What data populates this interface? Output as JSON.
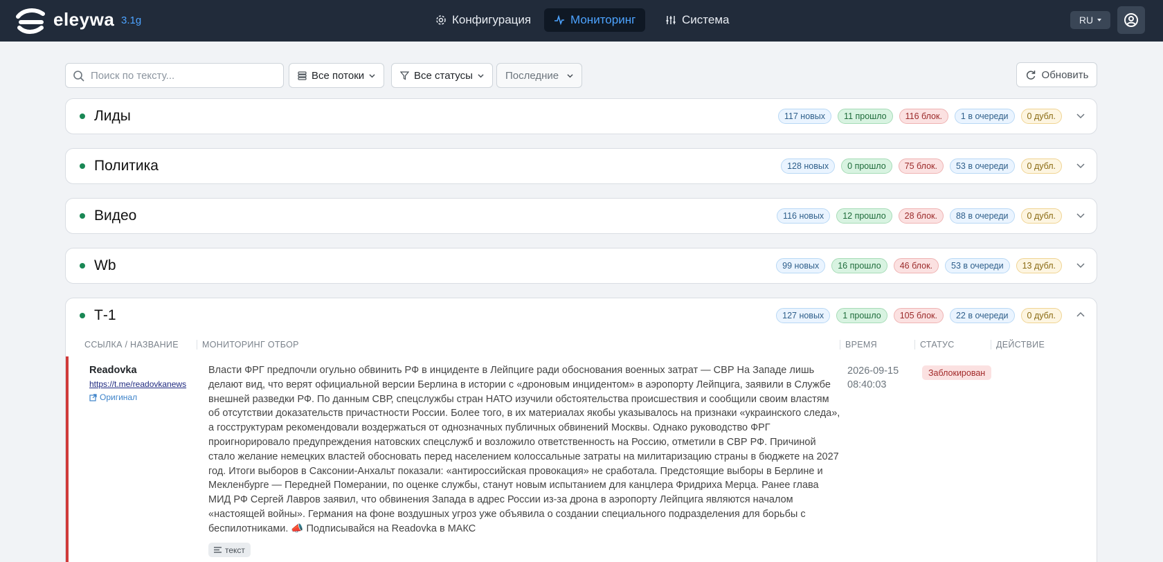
{
  "header": {
    "logo_text": "eleywa",
    "version": "3.1g",
    "nav": [
      {
        "label": "Конфигурация",
        "icon": "gear-icon",
        "active": false
      },
      {
        "label": "Мониторинг",
        "icon": "activity-icon",
        "active": true
      },
      {
        "label": "Система",
        "icon": "sliders-icon",
        "active": false
      }
    ],
    "lang": "RU",
    "user_icon": "user-circle-icon"
  },
  "filters": {
    "search_placeholder": "Поиск по тексту...",
    "streams_label": "Все потоки",
    "statuses_label": "Все статусы",
    "order_label": "Последние",
    "refresh_label": "Обновить"
  },
  "streams": [
    {
      "name": "Лиды",
      "new": "117 новых",
      "passed": "11 прошло",
      "blocked": "116 блок.",
      "queue": "1 в очереди",
      "dup": "0 дубл.",
      "expanded": false
    },
    {
      "name": "Политика",
      "new": "128 новых",
      "passed": "0 прошло",
      "blocked": "75 блок.",
      "queue": "53 в очереди",
      "dup": "0 дубл.",
      "expanded": false
    },
    {
      "name": "Видео",
      "new": "116 новых",
      "passed": "12 прошло",
      "blocked": "28 блок.",
      "queue": "88 в очереди",
      "dup": "0 дубл.",
      "expanded": false
    },
    {
      "name": "Wb",
      "new": "99 новых",
      "passed": "16 прошло",
      "blocked": "46 блок.",
      "queue": "53 в очереди",
      "dup": "13 дубл.",
      "expanded": false
    },
    {
      "name": "Т-1",
      "new": "127 новых",
      "passed": "1 прошло",
      "blocked": "105 блок.",
      "queue": "22 в очереди",
      "dup": "0 дубл.",
      "expanded": true
    }
  ],
  "table": {
    "columns": [
      "ССЫЛКА / НАЗВАНИЕ",
      "МОНИТОРИНГ ОТБОР",
      "ВРЕМЯ",
      "СТАТУС",
      "ДЕЙСТВИЕ"
    ],
    "row": {
      "source_name": "Readovka",
      "source_link": "https://t.me/readovkanews",
      "original_label": "Оригинал",
      "message": "Власти ФРГ предпочли огульно обвинить РФ в инциденте в Лейпциге ради обоснования военных затрат — СВР На Западе лишь делают вид, что верят официальной версии Берлина в истории с «дроновым инцидентом» в аэропорту Лейпцига, заявили в Службе внешней разведки РФ. По данным СВР, спецслужбы стран НАТО изучили обстоятельства происшествия и сообщили своим властям об отсутствии доказательств причастности России. Более того, в их материалах якобы указывалось на признаки «украинского следа», а госструктурам рекомендовали воздержаться от однозначных публичных обвинений Москвы. Однако руководство ФРГ проигнорировало предупреждения натовских спецслужб и возложило ответственность на Россию, отметили в СВР РФ. Причиной стало желание немецких властей обосновать перед населением колоссальные затраты на милитаризацию страны в бюджете на 2027 год. Итоги выборов в Саксонии-Анхальт показали: «антироссийская провокация» не сработала. Предстоящие выборы в Берлине и Мекленбурге — Передней Померании, по оценке службы, станут новым испытанием для канцлера Фридриха Мерца. Ранее глава МИД РФ Сергей Лавров заявил, что обвинения Запада в адрес России из-за дрона в аэропорту Лейпцига являются началом «настоящей войны». Германия на фоне воздушных угроз уже объявила о создании специального подразделения для борьбы с беспилотниками. 📣 Подписывайся на Readovka в МАКС",
      "tag": "текст",
      "date": "2026-09-15",
      "time": "08:40:03",
      "status": "Заблокирован"
    }
  },
  "colors": {
    "topbar": "#212b3a",
    "accent": "#4da3ff",
    "active_dot": "#198754",
    "blocked_bar": "#d03a3a"
  }
}
